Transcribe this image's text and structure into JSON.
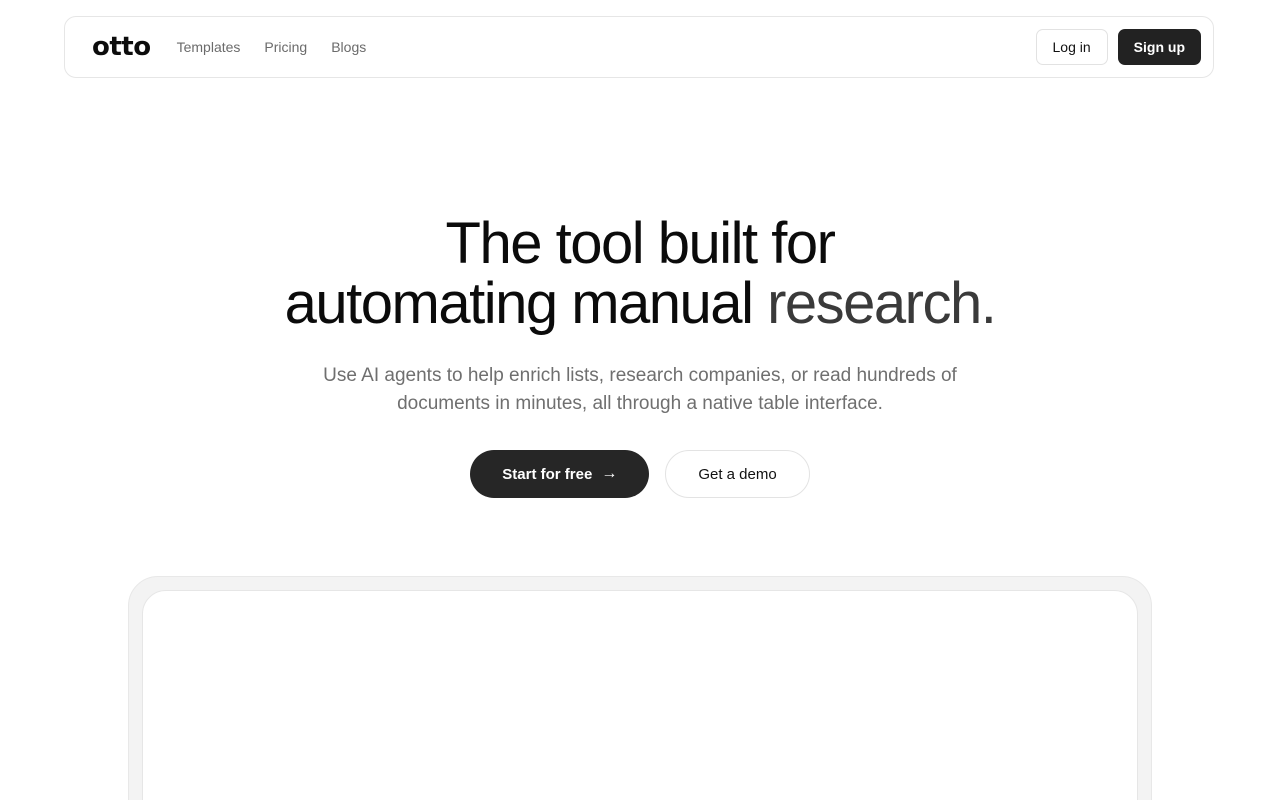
{
  "nav": {
    "logo": "otto",
    "links": [
      "Templates",
      "Pricing",
      "Blogs"
    ],
    "login_label": "Log in",
    "signup_label": "Sign up"
  },
  "hero": {
    "title_line1": "The tool built for",
    "title_line2_a": "automating manual ",
    "title_line2_b": "research.",
    "subtitle": "Use AI agents to help enrich lists, research companies, or read hundreds of documents in minutes, all through a native table interface.",
    "primary_cta": "Start for free",
    "primary_cta_icon": "arrow-right-icon",
    "secondary_cta": "Get a demo"
  },
  "colors": {
    "primary_button": "#262626",
    "text": "#0b0b0b",
    "muted_text": "#6f6f6f"
  }
}
